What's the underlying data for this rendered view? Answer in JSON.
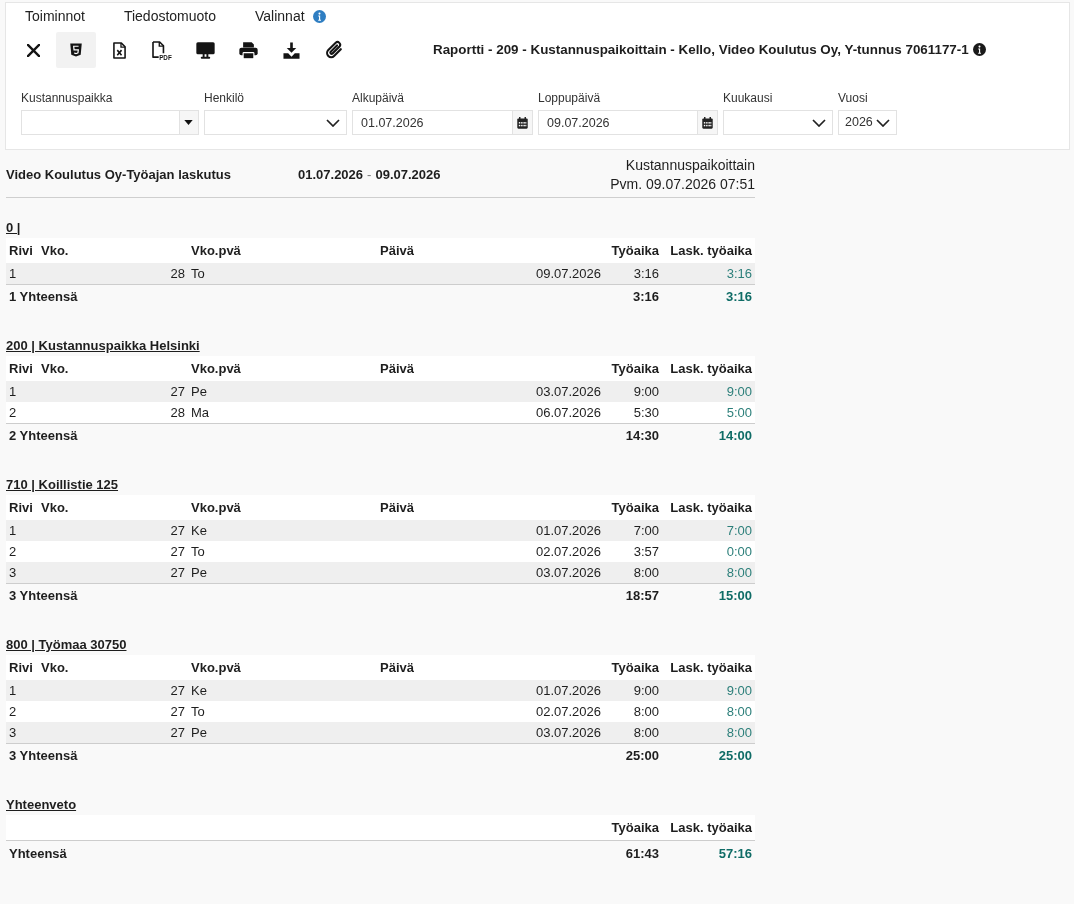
{
  "menu": [
    {
      "label": "Toiminnot",
      "info_icon": false
    },
    {
      "label": "Tiedostomuoto",
      "info_icon": false
    },
    {
      "label": "Valinnat",
      "info_icon": true
    }
  ],
  "toolbar": [
    {
      "kind": "close",
      "selected": false
    },
    {
      "kind": "html",
      "selected": true
    },
    {
      "kind": "excel",
      "selected": false
    },
    {
      "kind": "pdf",
      "selected": false,
      "icon_text": "PDF"
    },
    {
      "kind": "screen",
      "selected": false
    },
    {
      "kind": "print",
      "selected": false
    },
    {
      "kind": "download",
      "selected": false
    },
    {
      "kind": "attach",
      "selected": false
    }
  ],
  "report_title": "Raportti - 209 - Kustannuspaikoittain - Kello, Video Koulutus Oy, Y-tunnus 7061177-1",
  "filters": [
    {
      "label": "Kustannuspaikka",
      "kind": "combo"
    },
    {
      "label": "Henkilö",
      "kind": "select"
    },
    {
      "label": "Alkupäivä",
      "kind": "date",
      "value": "01.07.2026"
    },
    {
      "label": "Loppupäivä",
      "kind": "date",
      "value": "09.07.2026"
    },
    {
      "label": "Kuukausi",
      "kind": "select"
    },
    {
      "label": "Vuosi",
      "kind": "select",
      "value": "2026"
    }
  ],
  "report_header": {
    "title": "Video Koulutus Oy-Työajan laskutus",
    "period_start": "01.07.2026",
    "period_separator": "-",
    "period_end": "09.07.2026",
    "grouping": "Kustannuspaikoittain",
    "printed": "Pvm. 09.07.2026 07:51"
  },
  "sections": [
    {
      "heading": "0 |",
      "columns": [
        "Rivi",
        "Vko.",
        "Vko.pvä",
        "Päivä",
        "Työaika",
        "Lask. työaika"
      ],
      "rows": [
        [
          "1",
          "28",
          "To",
          "09.07.2026",
          "3:16",
          "3:16"
        ]
      ],
      "total": {
        "label": "1 Yhteensä",
        "tyoaika": "3:16",
        "lask_tyoaika": "3:16"
      }
    },
    {
      "heading": "200 | Kustannuspaikka Helsinki",
      "columns": [
        "Rivi",
        "Vko.",
        "Vko.pvä",
        "Päivä",
        "Työaika",
        "Lask. työaika"
      ],
      "rows": [
        [
          "1",
          "27",
          "Pe",
          "03.07.2026",
          "9:00",
          "9:00"
        ],
        [
          "2",
          "28",
          "Ma",
          "06.07.2026",
          "5:30",
          "5:00"
        ]
      ],
      "total": {
        "label": "2 Yhteensä",
        "tyoaika": "14:30",
        "lask_tyoaika": "14:00"
      }
    },
    {
      "heading": "710 | Koillistie 125",
      "columns": [
        "Rivi",
        "Vko.",
        "Vko.pvä",
        "Päivä",
        "Työaika",
        "Lask. työaika"
      ],
      "rows": [
        [
          "1",
          "27",
          "Ke",
          "01.07.2026",
          "7:00",
          "7:00"
        ],
        [
          "2",
          "27",
          "To",
          "02.07.2026",
          "3:57",
          "0:00"
        ],
        [
          "3",
          "27",
          "Pe",
          "03.07.2026",
          "8:00",
          "8:00"
        ]
      ],
      "total": {
        "label": "3 Yhteensä",
        "tyoaika": "18:57",
        "lask_tyoaika": "15:00"
      }
    },
    {
      "heading": "800 | Työmaa 30750",
      "columns": [
        "Rivi",
        "Vko.",
        "Vko.pvä",
        "Päivä",
        "Työaika",
        "Lask. työaika"
      ],
      "rows": [
        [
          "1",
          "27",
          "Ke",
          "01.07.2026",
          "9:00",
          "9:00"
        ],
        [
          "2",
          "27",
          "To",
          "02.07.2026",
          "8:00",
          "8:00"
        ],
        [
          "3",
          "27",
          "Pe",
          "03.07.2026",
          "8:00",
          "8:00"
        ]
      ],
      "total": {
        "label": "3 Yhteensä",
        "tyoaika": "25:00",
        "lask_tyoaika": "25:00"
      }
    }
  ],
  "summary": {
    "heading": "Yhteenveto",
    "columns": [
      "Työaika",
      "Lask. työaika"
    ],
    "total": {
      "label": "Yhteensä",
      "tyoaika": "61:43",
      "lask_tyoaika": "57:16"
    }
  }
}
